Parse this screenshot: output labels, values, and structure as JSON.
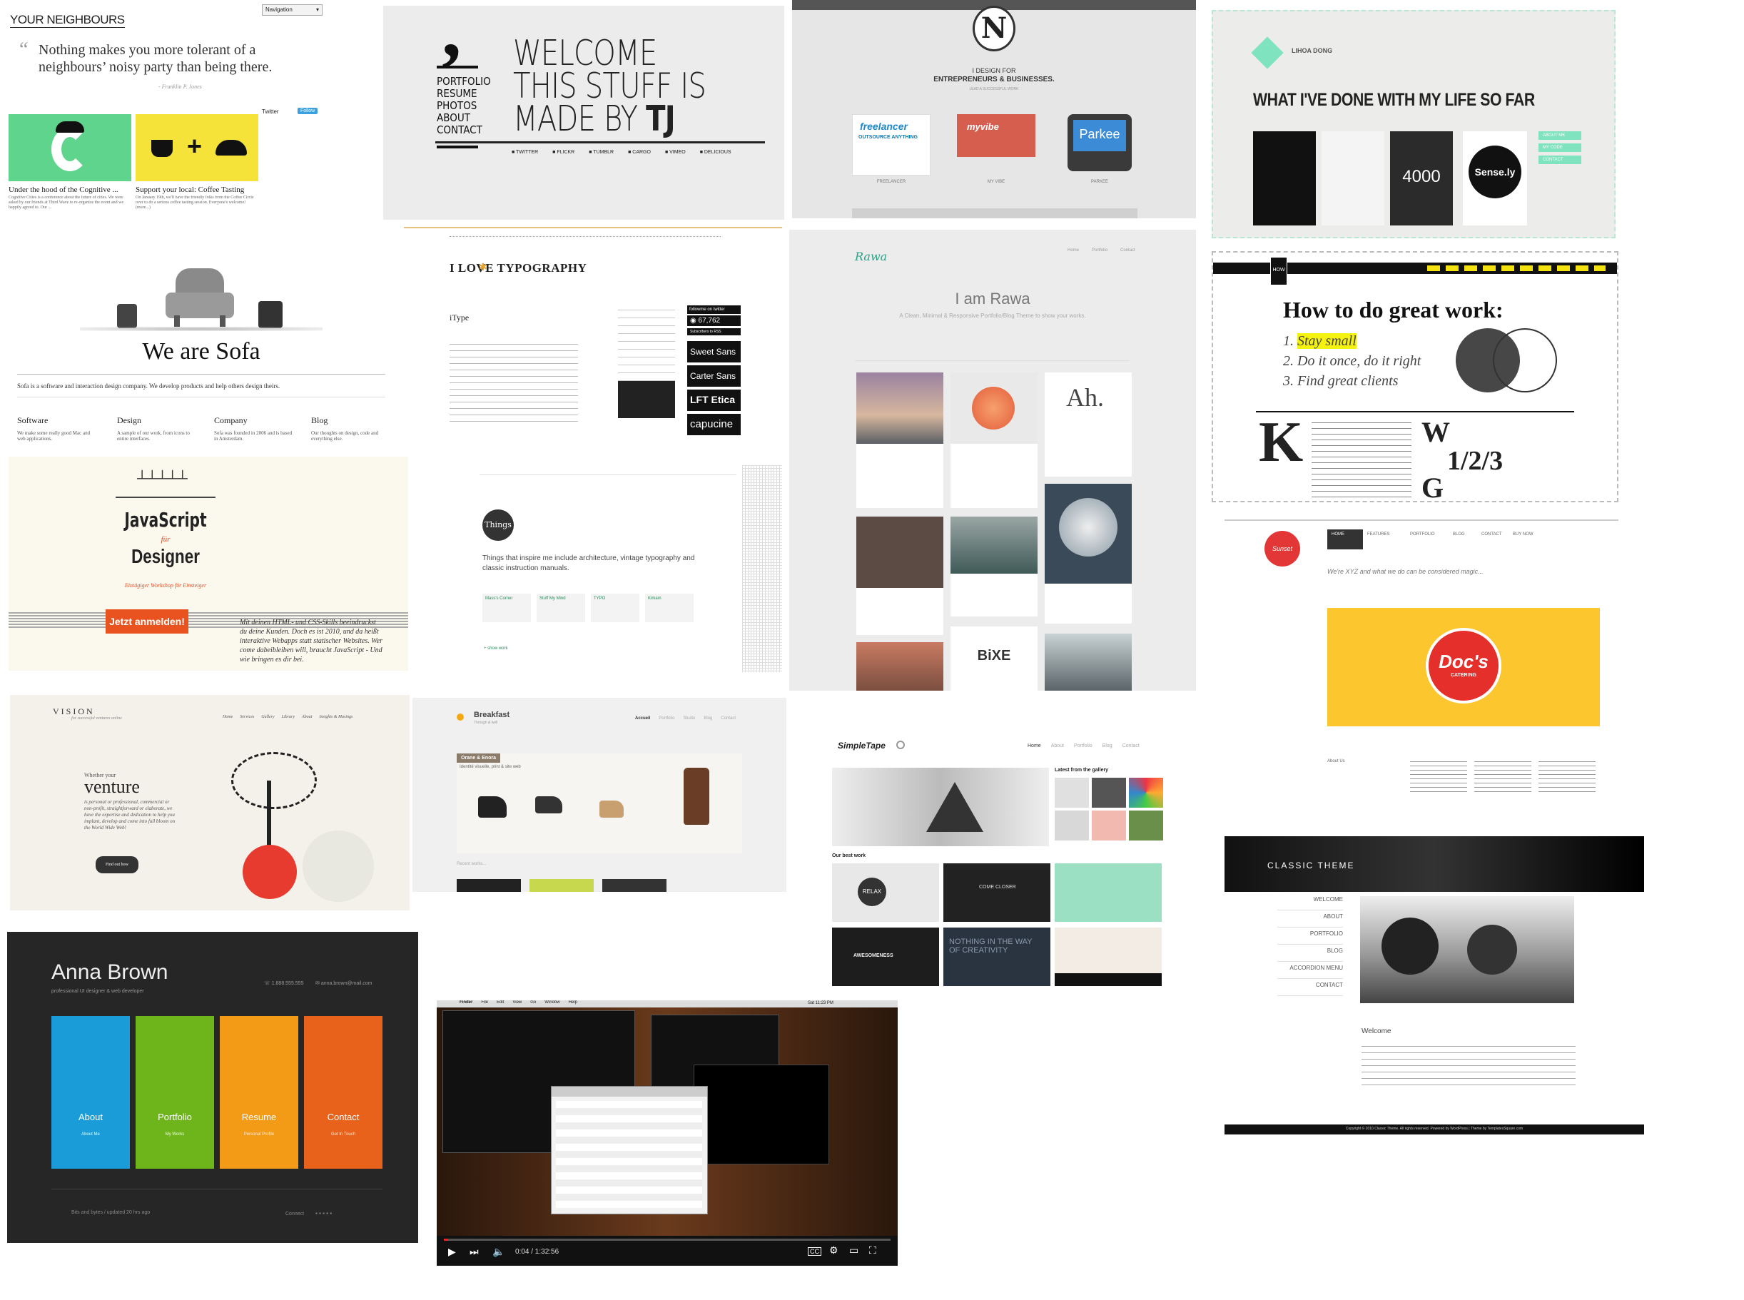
{
  "yn": {
    "title": "YOUR NEIGHBOURS",
    "nav": "Navigation",
    "quote": "Nothing makes you more tolerant of a neighbours’ noisy party than being there.",
    "author": "- Franklin P. Jones",
    "twitter": "Twitter",
    "follow": "Follow",
    "p1_title": "Under the hood of the Cognitive ...",
    "p1_text": "Cognitive Cities is a conference about the future of cities. We were asked by our friends at Third Wave to re-organize the event and we happily agreed to. Our ...",
    "p2_title": "Support your local: Coffee Tasting",
    "p2_text": "On January 19th, we'll have the friendly folks from the Coffee Circle over to do a serious coffee tasting session. Everyone's welcome! (more...)"
  },
  "tj": {
    "menu": [
      "PORTFOLIO",
      "RESUME",
      "PHOTOS",
      "ABOUT",
      "CONTACT"
    ],
    "headline": [
      "WELCOME",
      "THIS STUFF IS",
      "MADE BY"
    ],
    "initials": "TJ",
    "social": [
      "TWITTER",
      "FLICKR",
      "TUMBLR",
      "CARGO",
      "VIMEO",
      "DELICIOUS"
    ]
  },
  "n": {
    "logo": "N",
    "tagline": "I DESIGN FOR",
    "tagline2": "ENTREPRENEURS & BUSINESSES.",
    "sub": "LEAD A SUCCESSFUL WORK",
    "items": [
      {
        "brand": "freelancer",
        "caption": "OUTSOURCE ANYTHING",
        "label": "FREELANCER"
      },
      {
        "brand": "myvibe",
        "caption": "",
        "label": "MY VIBE"
      },
      {
        "brand": "Parkee",
        "caption": "",
        "label": "PARKEE"
      }
    ]
  },
  "lh": {
    "name": "LIHOA DONG",
    "headline": "WHAT I'VE DONE WITH MY LIFE SO FAR",
    "tile3": "4000",
    "tile4": "Sense.ly",
    "buttons": [
      "ABOUT ME",
      "MY CODE",
      "CONTACT"
    ]
  },
  "sofa": {
    "title": "We are Sofa",
    "desc": "Sofa is a software and interaction design company. We develop products and help others design theirs.",
    "cols": [
      {
        "h": "Software",
        "t": "We make some really good Mac and web applications."
      },
      {
        "h": "Design",
        "t": "A sample of our work, from icons to entire interfaces."
      },
      {
        "h": "Company",
        "t": "Sofa was founded in 2006 and is based in Amsterdam."
      },
      {
        "h": "Blog",
        "t": "Our thoughts on design, code and everything else."
      }
    ]
  },
  "ilt": {
    "logo": "I LOVE TYPOGRAPHY",
    "post_title": "iType",
    "fonts": [
      "Sweet Sans",
      "Carter Sans",
      "LFT Etica",
      "capucine"
    ],
    "counter": "67,762",
    "subscribe": "Subscribers to RSS",
    "follow": "followme on twitter"
  },
  "rawa": {
    "logo": "Rawa",
    "headline": "I am Rawa",
    "sub": "A Clean, Minimal & Responsive Portfolio/Blog Theme to show your works.",
    "nav": [
      "Home",
      "Portfolio",
      "Contact"
    ]
  },
  "hgw": {
    "logo": "HOW",
    "headline": "How to do great work:",
    "items": [
      "Stay small",
      "Do it once, do it right",
      "Find great clients"
    ],
    "big_letter": "K",
    "w_letter": "W",
    "g_letter": "G",
    "fraction": "1/2/3"
  },
  "js": {
    "line1": "JavaScript",
    "line2": "für",
    "line3": "Designer",
    "sub": "Eintägiger Workshop für Einsteiger",
    "cta": "Jetzt anmelden!",
    "body": "Mit deinen HTML- und CSS-Skills beeindruckst du deine Kunden. Doch es ist 2010, und da heißt interaktive Webapps statt statischer Websites. Wer come dabeibleiben will, braucht JavaScript - Und wie bringen es dir bei."
  },
  "things": {
    "badge": "Things",
    "text": "Things that inspire me include architecture, vintage typography and classic instruction manuals.",
    "links": [
      "Mass's Corner",
      "Stuff My Mind",
      "TYPO",
      "Kirkam"
    ],
    "more": "+ show work"
  },
  "xyz": {
    "logo": "Sunset",
    "nav": [
      "HOME",
      "FEATURES",
      "PORTFOLIO",
      "BLOG",
      "CONTACT",
      "BUY NOW"
    ],
    "tagline": "We're XYZ and what we do can be considered magic...",
    "doc_brand": "Doc's",
    "doc_sub": "CATERING",
    "about": "About Us"
  },
  "vision": {
    "brand": "VISION",
    "tag": "for successful ventures online",
    "nav": [
      "Home",
      "Services",
      "Gallery",
      "Library",
      "About",
      "Insights & Musings"
    ],
    "intro1": "Whether your",
    "big": "venture",
    "body": "is personal or professional, commercial or non-profit, straightforward or elaborate, we have the expertise and dedication to help you implant, develop and come into full bloom on the World Wide Web!",
    "btn": "Find out how"
  },
  "breakfast": {
    "logo": "Breakfast",
    "tag": "Through & well",
    "nav": [
      "Accueil",
      "Portfolio",
      "Studio",
      "Blog",
      "Contact"
    ],
    "caption": "Orane & Enora",
    "caption2": "Identité visuelle, print & site web",
    "recent": "Recent works..."
  },
  "simple": {
    "logo": "SimpleTape",
    "nav": [
      "Home",
      "About",
      "Portfolio",
      "Blog",
      "Contact"
    ],
    "gallery": "Latest from the gallery",
    "best": "Our best work",
    "thumbs": [
      "RELAX",
      "COME CLOSER",
      "",
      "AWESOMENESS",
      "NOTHING IN THE WAY OF CREATIVITY",
      ""
    ]
  },
  "classic": {
    "title": "CLASSIC THEME",
    "nav": [
      "WELCOME",
      "ABOUT",
      "PORTFOLIO",
      "BLOG",
      "ACCORDION MENU",
      "CONTACT"
    ],
    "welcome": "Welcome",
    "footer": "Copyright © 2010 Classic Theme. All rights reserved. Powered by WordPress | Theme by TemplatesSquare.com"
  },
  "anna": {
    "name": "Anna Brown",
    "sub": "professional UI designer & web developer",
    "phone": "1.888.555.555",
    "email": "anna.brown@mail.com",
    "tiles": [
      {
        "label": "About",
        "sub": "About Me",
        "color": "#1a9cd8"
      },
      {
        "label": "Portfolio",
        "sub": "My Works",
        "color": "#6eb51c"
      },
      {
        "label": "Resume",
        "sub": "Personal Profile",
        "color": "#f39a16"
      },
      {
        "label": "Contact",
        "sub": "Get In Touch",
        "color": "#e8621c"
      }
    ],
    "footer": "Bits and bytes / updated 20 hrs ago",
    "connect": "Connect"
  },
  "video": {
    "menu": [
      "Finder",
      "File",
      "Edit",
      "View",
      "Go",
      "Window",
      "Help"
    ],
    "time": "0:04 / 1:32:56",
    "clock": "Sat 11:23 PM"
  }
}
